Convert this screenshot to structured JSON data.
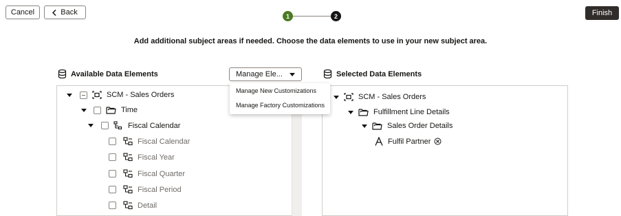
{
  "header": {
    "cancel_label": "Cancel",
    "back_label": "Back",
    "finish_label": "Finish",
    "steps": [
      "1",
      "2"
    ]
  },
  "instruction": "Add additional subject areas if needed. Choose the data elements to use in your new subject area.",
  "available": {
    "title": "Available Data Elements",
    "manage_label": "Manage Ele...",
    "menu": [
      "Manage New Customizations",
      "Manage Factory Customizations"
    ],
    "tree": {
      "root": "SCM - Sales Orders",
      "folder": "Time",
      "hierarchy": "Fiscal Calendar",
      "levels": [
        "Fiscal Calendar",
        "Fiscal Year",
        "Fiscal Quarter",
        "Fiscal Period",
        "Detail"
      ]
    }
  },
  "selected": {
    "title": "Selected Data Elements",
    "tree": {
      "root": "SCM - Sales Orders",
      "folder1": "Fulfillment Line Details",
      "folder2": "Sales Order Details",
      "attribute": "Fulfil Partner"
    }
  },
  "colors": {
    "step_done": "#4c7a24",
    "step_current": "#161513",
    "finish_bg": "#312d2a"
  }
}
